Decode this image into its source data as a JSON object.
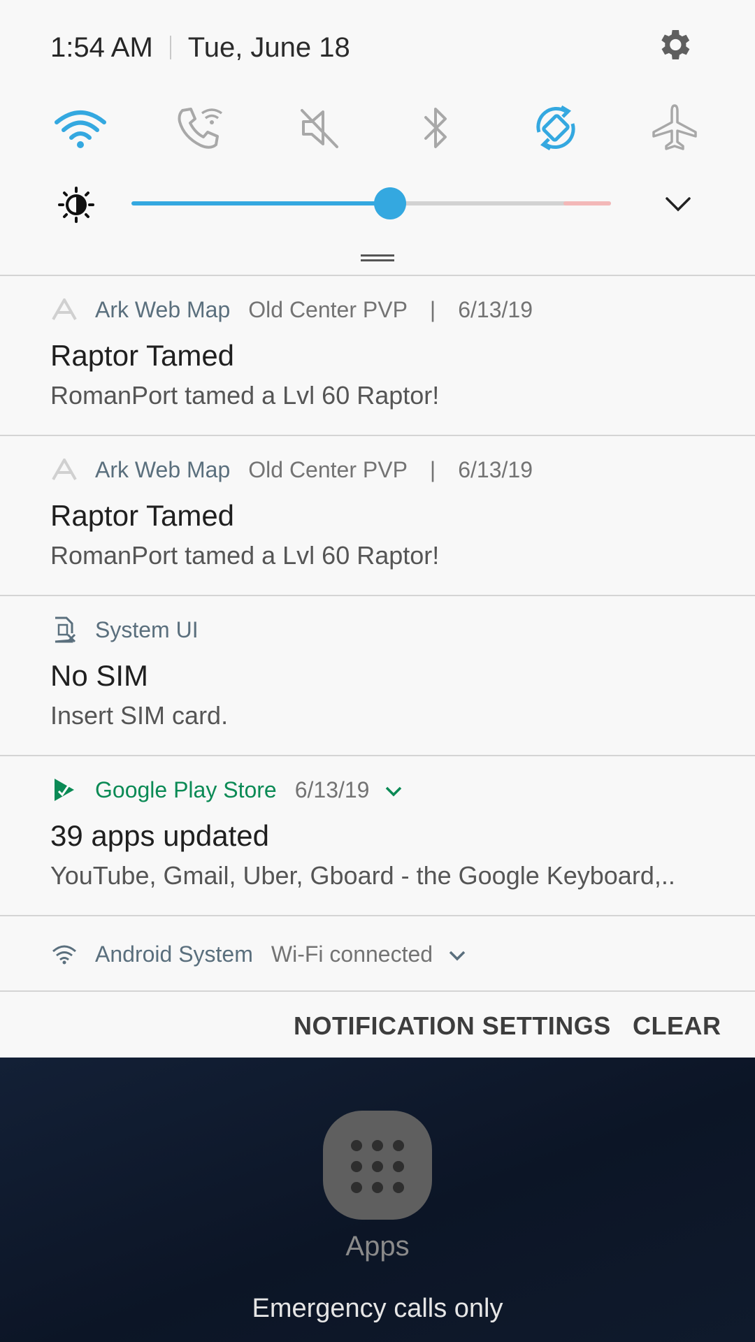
{
  "status": {
    "time": "1:54 AM",
    "date": "Tue, June 18"
  },
  "quick_settings": {
    "tiles": [
      {
        "name": "wifi-icon",
        "active": true
      },
      {
        "name": "wifi-calling-icon",
        "active": false
      },
      {
        "name": "mute-icon",
        "active": false
      },
      {
        "name": "bluetooth-icon",
        "active": false
      },
      {
        "name": "auto-rotate-icon",
        "active": true
      },
      {
        "name": "airplane-mode-icon",
        "active": false
      }
    ],
    "brightness_level": 0.54,
    "accent_color": "#34a8e0"
  },
  "notifications": [
    {
      "app": "Ark Web Map",
      "extra": "Old Center PVP",
      "sep": "|",
      "date": "6/13/19",
      "title": "Raptor Tamed",
      "body": "RomanPort tamed a Lvl 60 Raptor!"
    },
    {
      "app": "Ark Web Map",
      "extra": "Old Center PVP",
      "sep": "|",
      "date": "6/13/19",
      "title": "Raptor Tamed",
      "body": "RomanPort tamed a Lvl 60 Raptor!"
    },
    {
      "app": "System UI",
      "title": "No SIM",
      "body": "Insert SIM card."
    },
    {
      "app": "Google Play Store",
      "date": "6/13/19",
      "title": "39 apps updated",
      "body": "YouTube, Gmail, Uber, Gboard - the Google Keyboard,..",
      "app_color": "#0b8a55"
    },
    {
      "app": "Android System",
      "extra": "Wi-Fi connected"
    }
  ],
  "actions": {
    "settings_label": "NOTIFICATION SETTINGS",
    "clear_label": "CLEAR"
  },
  "lockscreen": {
    "apps_label": "Apps",
    "emergency": "Emergency calls only"
  }
}
